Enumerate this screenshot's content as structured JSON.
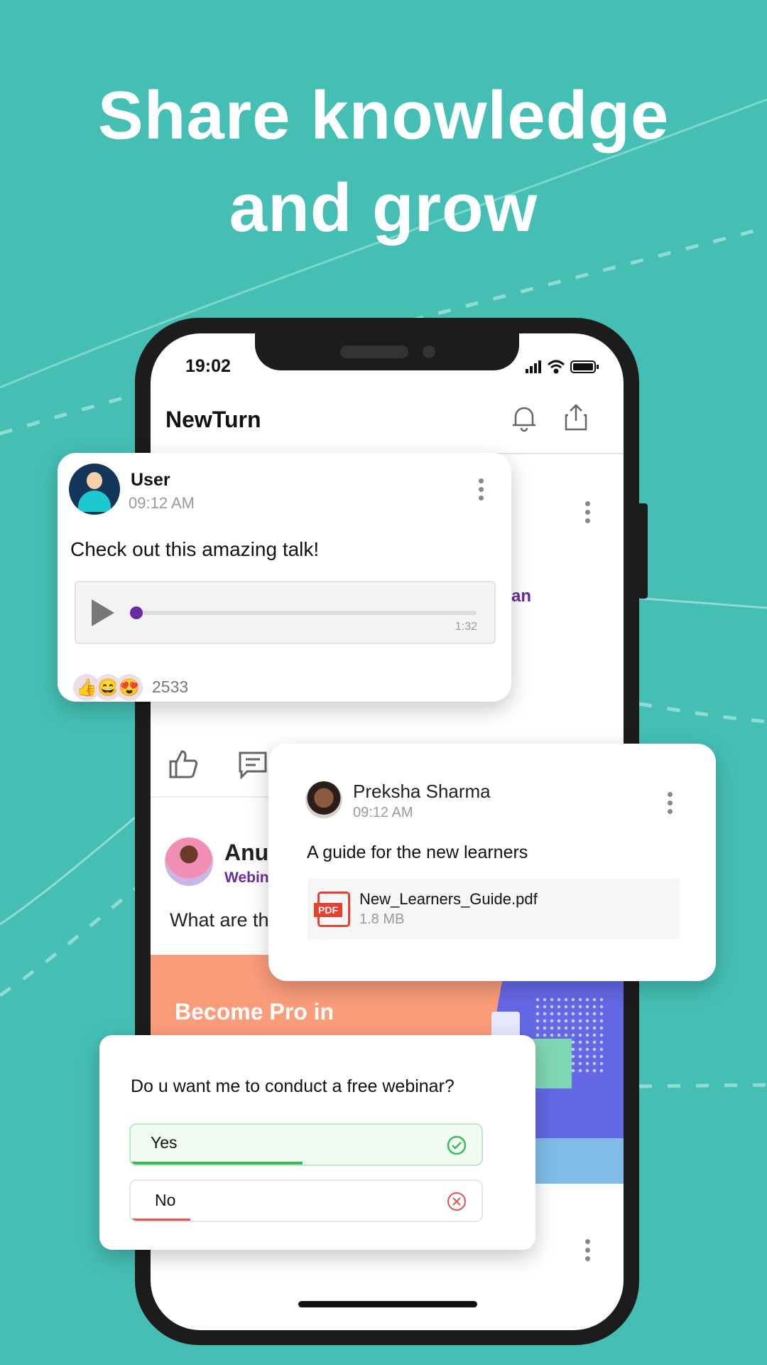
{
  "headline": {
    "line1": "Share knowledge",
    "line2": "and grow"
  },
  "status_bar": {
    "time": "19:02"
  },
  "app": {
    "title": "NewTurn"
  },
  "feed_behind": {
    "partial_link": "an",
    "post2_name": "Anu",
    "post2_sub": "Webin",
    "post2_text": "What are th",
    "banner_text": "Become Pro in"
  },
  "audio_post": {
    "user": "User",
    "time": "09:12 AM",
    "text": "Check out this amazing talk!",
    "duration": "1:32",
    "progress": 0.0,
    "reactions": [
      "👍",
      "😄",
      "😍"
    ],
    "reaction_count": "2533"
  },
  "file_post": {
    "user": "Preksha Sharma",
    "time": "09:12 AM",
    "text": "A guide for the new learners",
    "file_name": "New_Learners_Guide.pdf",
    "file_size": "1.8 MB",
    "file_icon_label": "PDF"
  },
  "poll": {
    "question": "Do u want me to conduct a free webinar?",
    "options": [
      {
        "label": "Yes",
        "percent": 49,
        "color": "#3cb95a"
      },
      {
        "label": "No",
        "percent": 17,
        "color": "#e0554f"
      }
    ]
  },
  "colors": {
    "background": "#45bfb4",
    "accent": "#6a2ba5",
    "pdf": "#e8402f"
  }
}
